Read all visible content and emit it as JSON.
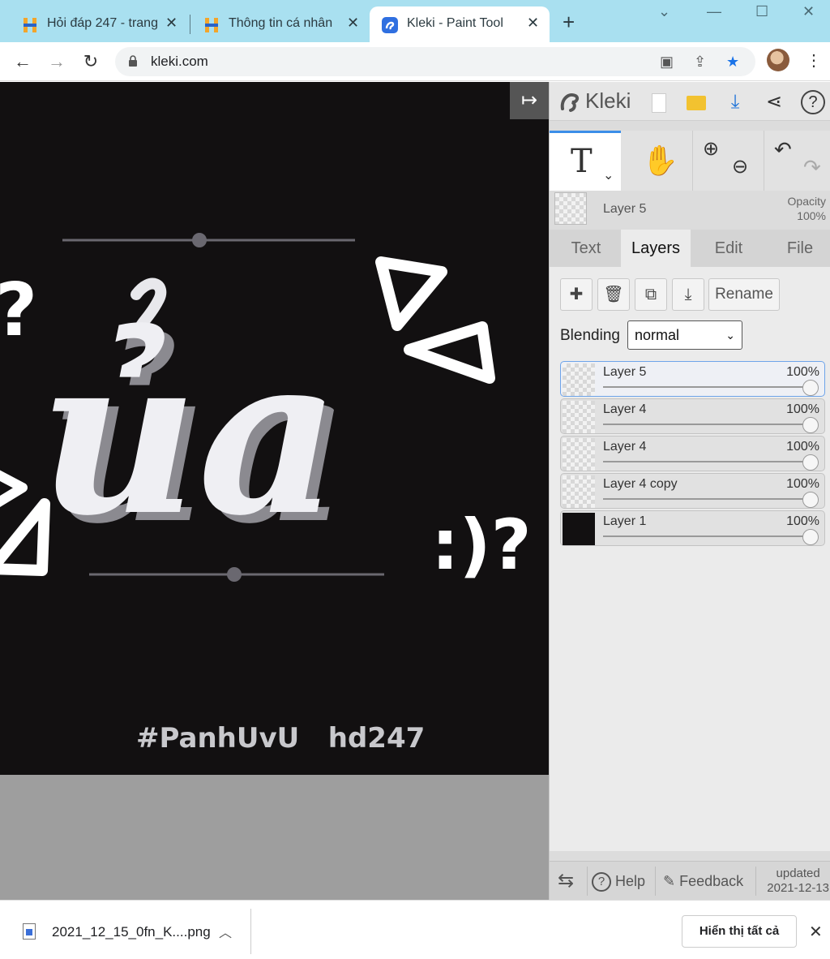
{
  "browser": {
    "tabs": [
      {
        "title": "Hỏi đáp 247 - trang"
      },
      {
        "title": "Thông tin cá nhân"
      },
      {
        "title": "Kleki - Paint Tool"
      }
    ],
    "new_tab_label": "+",
    "url": "kleki.com"
  },
  "artwork": {
    "caption": "#PanhUvU   hd247",
    "smiley": ":)?",
    "letters": "ủa"
  },
  "app": {
    "brand": "Kleki",
    "current_layer": "Layer 5",
    "opacity_label": "Opacity",
    "opacity_value": "100%",
    "tabs": [
      "Text",
      "Layers",
      "Edit",
      "File"
    ],
    "rename_label": "Rename",
    "blending_label": "Blending",
    "blending_value": "normal",
    "layers": [
      {
        "name": "Layer 5",
        "opacity": "100%"
      },
      {
        "name": "Layer 4",
        "opacity": "100%"
      },
      {
        "name": "Layer 4",
        "opacity": "100%"
      },
      {
        "name": "Layer 4 copy",
        "opacity": "100%"
      },
      {
        "name": "Layer 1",
        "opacity": "100%"
      }
    ],
    "footer": {
      "help": "Help",
      "feedback": "Feedback",
      "updated_label": "updated",
      "updated_date": "2021-12-13"
    }
  },
  "downloads": {
    "file_name": "2021_12_15_0fn_K....png",
    "show_all": "Hiển thị tất cả"
  },
  "colors": {
    "tabstrip": "#a9e0f0",
    "accent": "#3b8ee8",
    "artboard": "#121011"
  }
}
